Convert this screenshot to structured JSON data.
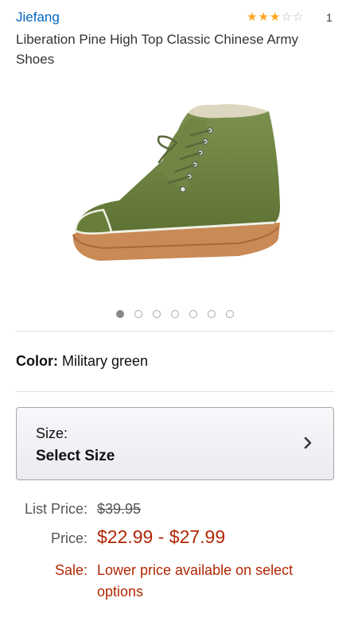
{
  "product": {
    "brand": "Jiefang",
    "rating_stars": 3,
    "rating_max": 5,
    "review_count": "1",
    "title": "Liberation Pine High Top Classic Chinese Army Shoes"
  },
  "gallery": {
    "image_icon": "green-canvas-high-top-shoe",
    "dot_count": 7,
    "active_index": 0
  },
  "color": {
    "label": "Color:",
    "value": "Military green"
  },
  "size": {
    "label": "Size:",
    "value": "Select Size",
    "icon": "chevron-right-icon"
  },
  "pricing": {
    "list_label": "List Price:",
    "list_value": "$39.95",
    "price_label": "Price:",
    "price_value": "$22.99 - $27.99",
    "sale_label": "Sale:",
    "sale_text": "Lower price available on select options"
  },
  "colors": {
    "link": "#0066c0",
    "star": "#ffa41c",
    "price": "#b12704",
    "shoe_canvas": "#6e8240",
    "shoe_sole": "#c98a55"
  }
}
